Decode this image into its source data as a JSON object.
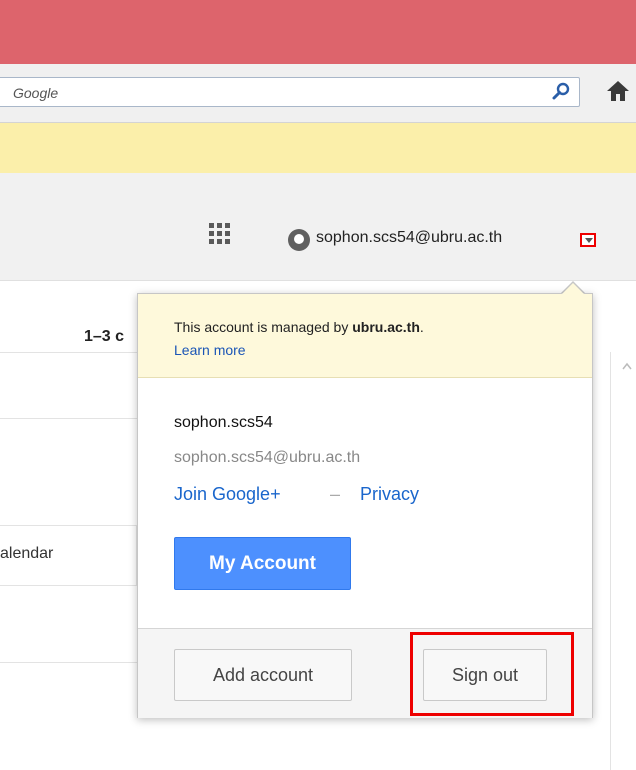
{
  "browser": {
    "search_placeholder": "Google",
    "search_icon": "search-icon",
    "home_icon": "home-icon",
    "titlebar_color": "#dd646c",
    "infobar_color": "#fbefaa"
  },
  "google_bar": {
    "apps_icon": "apps-grid-icon",
    "account_email": "sophon.scs54@ubru.ac.th",
    "avatar_icon": "avatar-icon",
    "dropdown_icon": "chevron-down-icon"
  },
  "background": {
    "count_text": "1–3 c",
    "calendar_label": "alendar"
  },
  "account_popup": {
    "managed_prefix": "This account is managed by ",
    "managed_domain": "ubru.ac.th",
    "managed_suffix": ".",
    "learn_more": "Learn more",
    "username": "sophon.scs54",
    "email": "sophon.scs54@ubru.ac.th",
    "join_google_plus": "Join Google+",
    "separator": "–",
    "privacy": "Privacy",
    "my_account_button": "My Account",
    "add_account_button": "Add account",
    "sign_out_button": "Sign out",
    "accent_color": "#4d90fe",
    "highlight_color": "#ee0000"
  }
}
